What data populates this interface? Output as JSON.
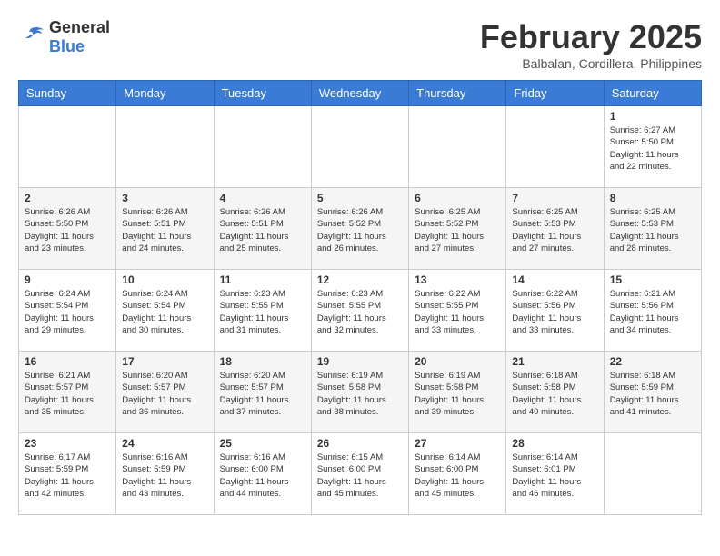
{
  "header": {
    "logo": {
      "general": "General",
      "blue": "Blue"
    },
    "title": "February 2025",
    "location": "Balbalan, Cordillera, Philippines"
  },
  "calendar": {
    "days_of_week": [
      "Sunday",
      "Monday",
      "Tuesday",
      "Wednesday",
      "Thursday",
      "Friday",
      "Saturday"
    ],
    "weeks": [
      [
        {
          "day": "",
          "info": ""
        },
        {
          "day": "",
          "info": ""
        },
        {
          "day": "",
          "info": ""
        },
        {
          "day": "",
          "info": ""
        },
        {
          "day": "",
          "info": ""
        },
        {
          "day": "",
          "info": ""
        },
        {
          "day": "1",
          "info": "Sunrise: 6:27 AM\nSunset: 5:50 PM\nDaylight: 11 hours and 22 minutes."
        }
      ],
      [
        {
          "day": "2",
          "info": "Sunrise: 6:26 AM\nSunset: 5:50 PM\nDaylight: 11 hours and 23 minutes."
        },
        {
          "day": "3",
          "info": "Sunrise: 6:26 AM\nSunset: 5:51 PM\nDaylight: 11 hours and 24 minutes."
        },
        {
          "day": "4",
          "info": "Sunrise: 6:26 AM\nSunset: 5:51 PM\nDaylight: 11 hours and 25 minutes."
        },
        {
          "day": "5",
          "info": "Sunrise: 6:26 AM\nSunset: 5:52 PM\nDaylight: 11 hours and 26 minutes."
        },
        {
          "day": "6",
          "info": "Sunrise: 6:25 AM\nSunset: 5:52 PM\nDaylight: 11 hours and 27 minutes."
        },
        {
          "day": "7",
          "info": "Sunrise: 6:25 AM\nSunset: 5:53 PM\nDaylight: 11 hours and 27 minutes."
        },
        {
          "day": "8",
          "info": "Sunrise: 6:25 AM\nSunset: 5:53 PM\nDaylight: 11 hours and 28 minutes."
        }
      ],
      [
        {
          "day": "9",
          "info": "Sunrise: 6:24 AM\nSunset: 5:54 PM\nDaylight: 11 hours and 29 minutes."
        },
        {
          "day": "10",
          "info": "Sunrise: 6:24 AM\nSunset: 5:54 PM\nDaylight: 11 hours and 30 minutes."
        },
        {
          "day": "11",
          "info": "Sunrise: 6:23 AM\nSunset: 5:55 PM\nDaylight: 11 hours and 31 minutes."
        },
        {
          "day": "12",
          "info": "Sunrise: 6:23 AM\nSunset: 5:55 PM\nDaylight: 11 hours and 32 minutes."
        },
        {
          "day": "13",
          "info": "Sunrise: 6:22 AM\nSunset: 5:55 PM\nDaylight: 11 hours and 33 minutes."
        },
        {
          "day": "14",
          "info": "Sunrise: 6:22 AM\nSunset: 5:56 PM\nDaylight: 11 hours and 33 minutes."
        },
        {
          "day": "15",
          "info": "Sunrise: 6:21 AM\nSunset: 5:56 PM\nDaylight: 11 hours and 34 minutes."
        }
      ],
      [
        {
          "day": "16",
          "info": "Sunrise: 6:21 AM\nSunset: 5:57 PM\nDaylight: 11 hours and 35 minutes."
        },
        {
          "day": "17",
          "info": "Sunrise: 6:20 AM\nSunset: 5:57 PM\nDaylight: 11 hours and 36 minutes."
        },
        {
          "day": "18",
          "info": "Sunrise: 6:20 AM\nSunset: 5:57 PM\nDaylight: 11 hours and 37 minutes."
        },
        {
          "day": "19",
          "info": "Sunrise: 6:19 AM\nSunset: 5:58 PM\nDaylight: 11 hours and 38 minutes."
        },
        {
          "day": "20",
          "info": "Sunrise: 6:19 AM\nSunset: 5:58 PM\nDaylight: 11 hours and 39 minutes."
        },
        {
          "day": "21",
          "info": "Sunrise: 6:18 AM\nSunset: 5:58 PM\nDaylight: 11 hours and 40 minutes."
        },
        {
          "day": "22",
          "info": "Sunrise: 6:18 AM\nSunset: 5:59 PM\nDaylight: 11 hours and 41 minutes."
        }
      ],
      [
        {
          "day": "23",
          "info": "Sunrise: 6:17 AM\nSunset: 5:59 PM\nDaylight: 11 hours and 42 minutes."
        },
        {
          "day": "24",
          "info": "Sunrise: 6:16 AM\nSunset: 5:59 PM\nDaylight: 11 hours and 43 minutes."
        },
        {
          "day": "25",
          "info": "Sunrise: 6:16 AM\nSunset: 6:00 PM\nDaylight: 11 hours and 44 minutes."
        },
        {
          "day": "26",
          "info": "Sunrise: 6:15 AM\nSunset: 6:00 PM\nDaylight: 11 hours and 45 minutes."
        },
        {
          "day": "27",
          "info": "Sunrise: 6:14 AM\nSunset: 6:00 PM\nDaylight: 11 hours and 45 minutes."
        },
        {
          "day": "28",
          "info": "Sunrise: 6:14 AM\nSunset: 6:01 PM\nDaylight: 11 hours and 46 minutes."
        },
        {
          "day": "",
          "info": ""
        }
      ]
    ]
  }
}
